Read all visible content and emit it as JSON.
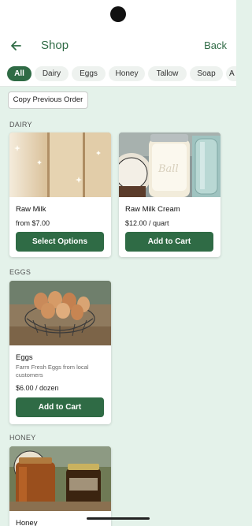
{
  "app_bar": {
    "title": "Shop",
    "back_label": "Back"
  },
  "categories": [
    {
      "label": "All",
      "active": true
    },
    {
      "label": "Dairy",
      "active": false
    },
    {
      "label": "Eggs",
      "active": false
    },
    {
      "label": "Honey",
      "active": false
    },
    {
      "label": "Tallow",
      "active": false
    },
    {
      "label": "Soap",
      "active": false
    },
    {
      "label": "A",
      "active": false
    }
  ],
  "copy_order_label": "Copy Previous Order",
  "sections": {
    "dairy": {
      "label": "DAIRY",
      "products": [
        {
          "name": "Raw Milk",
          "price": "from $7.00",
          "button": "Select Options"
        },
        {
          "name": "Raw Milk Cream",
          "price": "$12.00 / quart",
          "button": "Add to Cart"
        }
      ]
    },
    "eggs": {
      "label": "EGGS",
      "products": [
        {
          "name": "Eggs",
          "description": "Farm Fresh Eggs from local customers",
          "price": "$6.00 / dozen",
          "button": "Add to Cart"
        }
      ]
    },
    "honey": {
      "label": "HONEY",
      "products": [
        {
          "name": "Honey"
        }
      ]
    }
  },
  "icons": {
    "back": "arrow-left-icon"
  },
  "colors": {
    "primary": "#2f6b45",
    "background": "#e4f2ea"
  }
}
